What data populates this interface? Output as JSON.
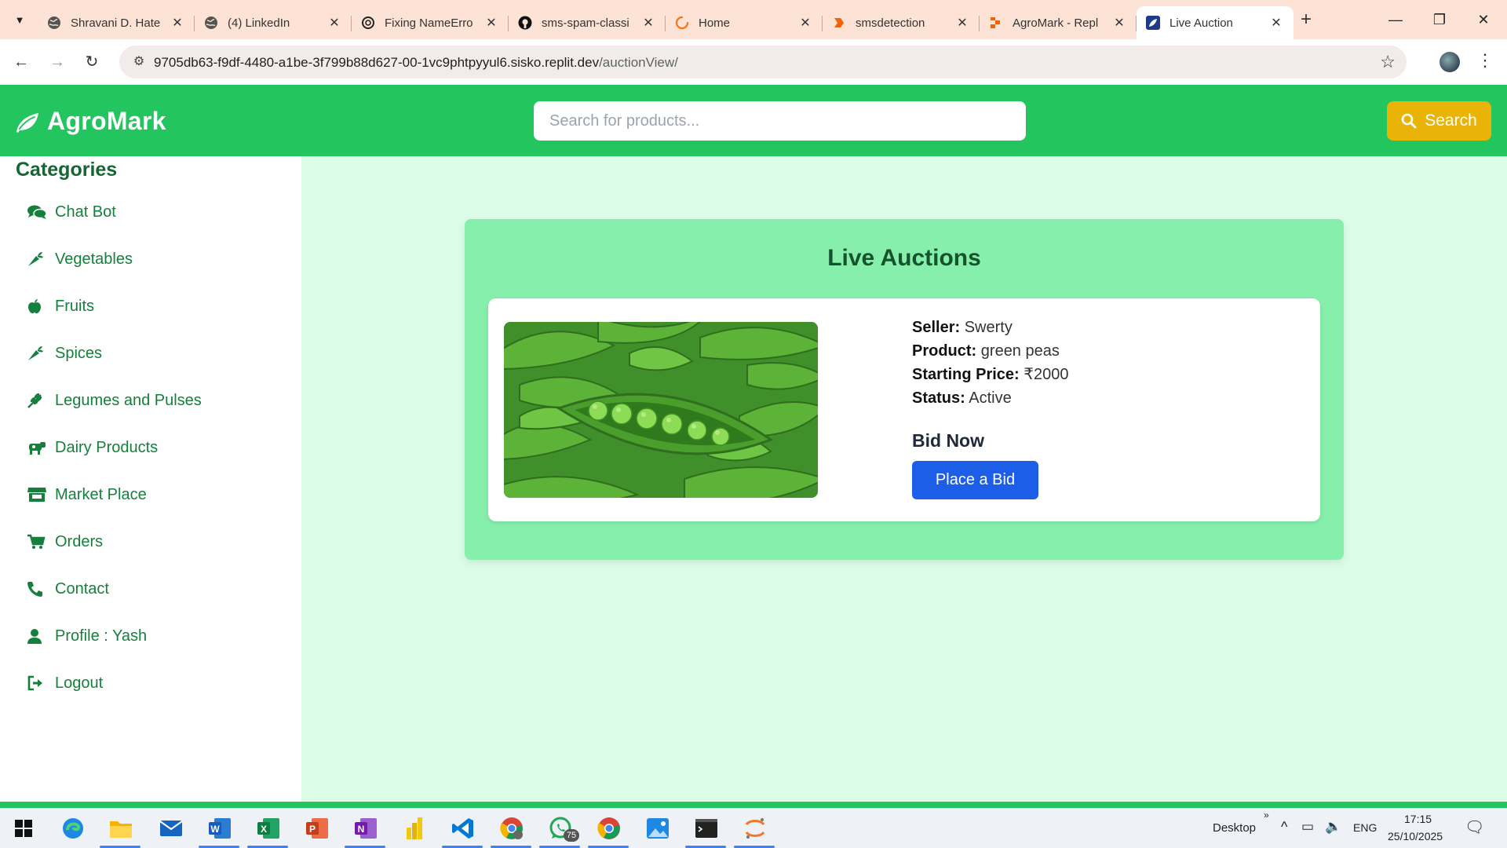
{
  "browser": {
    "tabs": [
      {
        "title": "Shravani D. Hate",
        "icon": "globe-icon"
      },
      {
        "title": "(4) LinkedIn",
        "icon": "globe-icon"
      },
      {
        "title": "Fixing NameErro",
        "icon": "openai-icon"
      },
      {
        "title": "sms-spam-classi",
        "icon": "github-icon"
      },
      {
        "title": "Home",
        "icon": "loading-icon"
      },
      {
        "title": "smsdetection",
        "icon": "replit-icon"
      },
      {
        "title": "AgroMark - Repl",
        "icon": "replit-icon"
      },
      {
        "title": "Live Auction",
        "icon": "leaf-icon",
        "active": true
      }
    ],
    "url_host": "9705db63-f9df-4480-a1be-3f799b88d627-00-1vc9phtpyyul6.sisko.replit.dev",
    "url_path": "/auctionView/"
  },
  "header": {
    "brand": "AgroMark",
    "search_placeholder": "Search for products...",
    "search_label": "Search"
  },
  "sidebar": {
    "title": "Categories",
    "items": [
      {
        "label": "Chat Bot",
        "icon": "comments-icon"
      },
      {
        "label": "Vegetables",
        "icon": "carrot-icon"
      },
      {
        "label": "Fruits",
        "icon": "apple-icon"
      },
      {
        "label": "Spices",
        "icon": "pepper-icon"
      },
      {
        "label": "Legumes and Pulses",
        "icon": "seedling-icon"
      },
      {
        "label": "Dairy Products",
        "icon": "cow-icon"
      },
      {
        "label": "Market Place",
        "icon": "store-icon"
      },
      {
        "label": "Orders",
        "icon": "cart-icon"
      },
      {
        "label": "Contact",
        "icon": "phone-icon"
      },
      {
        "label": "Profile : Yash",
        "icon": "user-icon"
      },
      {
        "label": "Logout",
        "icon": "logout-icon"
      }
    ]
  },
  "auction": {
    "title": "Live Auctions",
    "seller_label": "Seller:",
    "seller": "Swerty",
    "product_label": "Product:",
    "product": "green peas",
    "price_label": "Starting Price:",
    "price": "₹2000",
    "status_label": "Status:",
    "status": "Active",
    "bid_heading": "Bid Now",
    "bid_button": "Place a Bid"
  },
  "taskbar": {
    "desktop_label": "Desktop",
    "whatsapp_badge": "75",
    "lang": "ENG",
    "time": "17:15",
    "date": "25/10/2025"
  },
  "colors": {
    "brand_green": "#22c55e",
    "panel_green": "#86efac",
    "main_bg": "#dcfce7",
    "search_yellow": "#eab308",
    "bid_blue": "#1d5ee8"
  }
}
